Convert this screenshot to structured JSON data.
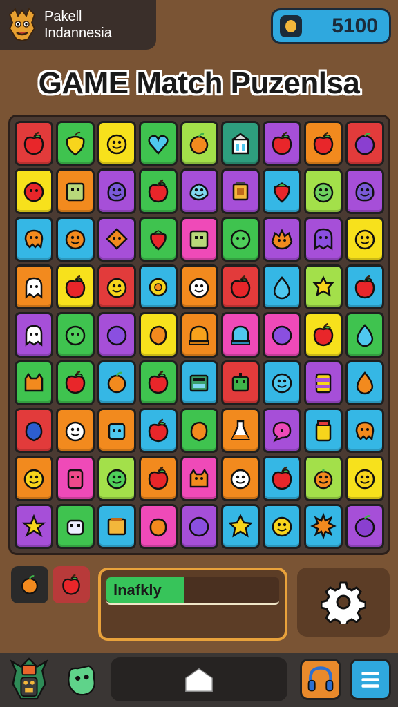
{
  "brand": {
    "line1": "Pakell",
    "line2": "Indannesia",
    "logo_icon": "garuda-mask-icon"
  },
  "score": {
    "value": "5100",
    "icon": "coin-icon"
  },
  "title": "GAME Match Puzenlsa",
  "board": {
    "rows": 9,
    "cols": 9,
    "tiles": [
      [
        [
          "#e23b3b",
          "apple"
        ],
        [
          "#3fc34f",
          "lemon"
        ],
        [
          "#f7e11c",
          "smiley"
        ],
        [
          "#3fc34f",
          "heart"
        ],
        [
          "#a3e04a",
          "orange"
        ],
        [
          "#2e9e7e",
          "house"
        ],
        [
          "#a64fd8",
          "apple"
        ],
        [
          "#f28a1e",
          "apple"
        ],
        [
          "#e23b3b",
          "plum"
        ]
      ],
      [
        [
          "#f7e11c",
          "tomato"
        ],
        [
          "#f28a1e",
          "box"
        ],
        [
          "#a64fd8",
          "blob"
        ],
        [
          "#3fc34f",
          "apple"
        ],
        [
          "#a64fd8",
          "cloud"
        ],
        [
          "#a64fd8",
          "lantern"
        ],
        [
          "#35b7e5",
          "strawberry"
        ],
        [
          "#a3e04a",
          "frog"
        ],
        [
          "#a64fd8",
          "blob"
        ]
      ],
      [
        [
          "#35b7e5",
          "squid"
        ],
        [
          "#35b7e5",
          "smiley-orange"
        ],
        [
          "#a64fd8",
          "diamond"
        ],
        [
          "#3fc34f",
          "strawberry"
        ],
        [
          "#ef4ab8",
          "box"
        ],
        [
          "#3fc34f",
          "lime"
        ],
        [
          "#a64fd8",
          "monster"
        ],
        [
          "#a64fd8",
          "ghost"
        ],
        [
          "#f7e11c",
          "smiley"
        ]
      ],
      [
        [
          "#f28a1e",
          "ghost-white"
        ],
        [
          "#f7e11c",
          "apple"
        ],
        [
          "#e23b3b",
          "smiley"
        ],
        [
          "#35b7e5",
          "sun"
        ],
        [
          "#f28a1e",
          "face-white"
        ],
        [
          "#e23b3b",
          "apple"
        ],
        [
          "#35b7e5",
          "drop"
        ],
        [
          "#a3e04a",
          "star-badge"
        ],
        [
          "#35b7e5",
          "apple"
        ]
      ],
      [
        [
          "#a64fd8",
          "ghost-white"
        ],
        [
          "#3fc34f",
          "lime"
        ],
        [
          "#a64fd8",
          "grape"
        ],
        [
          "#f7e11c",
          "mango"
        ],
        [
          "#f28a1e",
          "dome"
        ],
        [
          "#ef4ab8",
          "dome-blue"
        ],
        [
          "#ef4ab8",
          "grape"
        ],
        [
          "#f7e11c",
          "apple"
        ],
        [
          "#3fc34f",
          "drop"
        ]
      ],
      [
        [
          "#3fc34f",
          "cat"
        ],
        [
          "#3fc34f",
          "apple"
        ],
        [
          "#35b7e5",
          "orange"
        ],
        [
          "#3fc34f",
          "apple"
        ],
        [
          "#35b7e5",
          "tank"
        ],
        [
          "#e23b3b",
          "robot"
        ],
        [
          "#35b7e5",
          "smiley-blue"
        ],
        [
          "#a64fd8",
          "can"
        ],
        [
          "#35b7e5",
          "drop-orange"
        ]
      ],
      [
        [
          "#e23b3b",
          "berry"
        ],
        [
          "#f28a1e",
          "face-white"
        ],
        [
          "#f28a1e",
          "jelly"
        ],
        [
          "#35b7e5",
          "apple"
        ],
        [
          "#3fc34f",
          "mango"
        ],
        [
          "#f28a1e",
          "potion"
        ],
        [
          "#a64fd8",
          "speech"
        ],
        [
          "#35b7e5",
          "jar"
        ],
        [
          "#35b7e5",
          "squid"
        ]
      ],
      [
        [
          "#f28a1e",
          "smiley"
        ],
        [
          "#ef4ab8",
          "cup"
        ],
        [
          "#a3e04a",
          "lime-face"
        ],
        [
          "#f28a1e",
          "apple"
        ],
        [
          "#ef4ab8",
          "cat-orange"
        ],
        [
          "#f28a1e",
          "face-white"
        ],
        [
          "#35b7e5",
          "apple"
        ],
        [
          "#a3e04a",
          "pumpkin"
        ],
        [
          "#f7e11c",
          "smiley"
        ]
      ],
      [
        [
          "#a64fd8",
          "starfish"
        ],
        [
          "#3fc34f",
          "robot-white"
        ],
        [
          "#35b7e5",
          "box-yellow"
        ],
        [
          "#ef4ab8",
          "peach"
        ],
        [
          "#a64fd8",
          "grape"
        ],
        [
          "#35b7e5",
          "star"
        ],
        [
          "#35b7e5",
          "smiley"
        ],
        [
          "#35b7e5",
          "spiky"
        ],
        [
          "#a64fd8",
          "plum"
        ]
      ]
    ]
  },
  "reserve": [
    {
      "color": "#2a2a2a",
      "item": "orange"
    },
    {
      "color": "#b83a3a",
      "item": "apple"
    }
  ],
  "progress": {
    "label": "lnafkly",
    "fill": 0.45
  },
  "settings_icon": "gear-icon",
  "nav": {
    "left_icon": "tribal-mask-icon",
    "left2_icon": "green-monster-icon",
    "home_icon": "home-icon",
    "right1_icon": "headphones-icon",
    "right2_icon": "menu-icon"
  }
}
